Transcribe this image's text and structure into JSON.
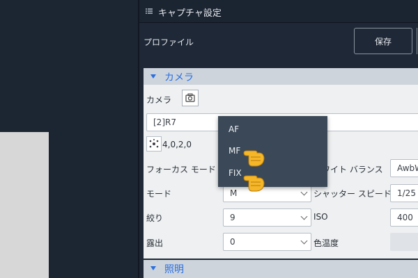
{
  "panel": {
    "title": "キャプチャ設定"
  },
  "profile": {
    "label": "プロファイル",
    "save_label": "保存"
  },
  "camera_section": {
    "title": "カメラ",
    "camera_label": "カメラ",
    "camera_value": "[2]R7",
    "coords_value": "4,0,2,0",
    "rows": [
      {
        "label": "フォーカス モード",
        "value": "",
        "right_label": "ホワイト バランス",
        "right_value": "AwbW"
      },
      {
        "label": "モード",
        "value": "M",
        "right_label": "シャッター スピード",
        "right_value": "1/25"
      },
      {
        "label": "絞り",
        "value": "9",
        "right_label": "ISO",
        "right_value": "400"
      },
      {
        "label": "露出",
        "value": "0",
        "right_label": "色温度",
        "right_value": ""
      }
    ]
  },
  "lighting_section": {
    "title": "照明"
  },
  "focus_dropdown": {
    "options": [
      "AF",
      "MF",
      "FIX"
    ]
  },
  "colors": {
    "accent": "#2a6fe0",
    "panel_bg": "#1e2836",
    "dropdown_bg": "#3b4857",
    "section_bg": "#eef0f2"
  },
  "icons": [
    "grip-icon",
    "camera-icon",
    "target-icon",
    "chevron-down-icon",
    "pointing-hand-icon"
  ]
}
